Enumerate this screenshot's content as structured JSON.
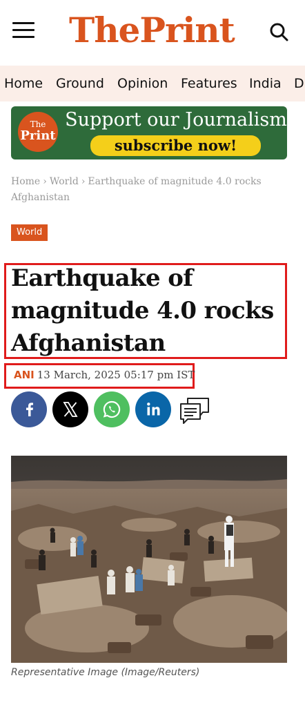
{
  "header": {
    "logo_part1": "The",
    "logo_part2": "Print",
    "brand_color": "#d9541e",
    "menu_icon": "hamburger-menu-icon",
    "search_icon": "search-icon"
  },
  "nav": {
    "items": [
      {
        "label": "Home"
      },
      {
        "label": "Ground"
      },
      {
        "label": "Opinion"
      },
      {
        "label": "Features"
      },
      {
        "label": "India"
      },
      {
        "label": "Di"
      }
    ]
  },
  "banner": {
    "badge_small": "The",
    "badge_large": "Print",
    "title": "Support our Journalism",
    "button_label": "subscribe now!"
  },
  "breadcrumb": {
    "home": "Home",
    "section": "World",
    "current": "Earthquake of magnitude 4.0 rocks Afghanistan",
    "separator": "›"
  },
  "article": {
    "category": "World",
    "headline": "Earthquake of magnitude 4.0 rocks Afghanistan",
    "author": "ANI",
    "date": "13 March, 2025 05:17 pm IST",
    "caption": "Representative Image (Image/Reuters)"
  },
  "share": {
    "facebook_color": "#3b5998",
    "x_color": "#000000",
    "whatsapp_color": "#4fbf60",
    "linkedin_color": "#0a66a8",
    "highlight_color": "#e01b1b"
  }
}
